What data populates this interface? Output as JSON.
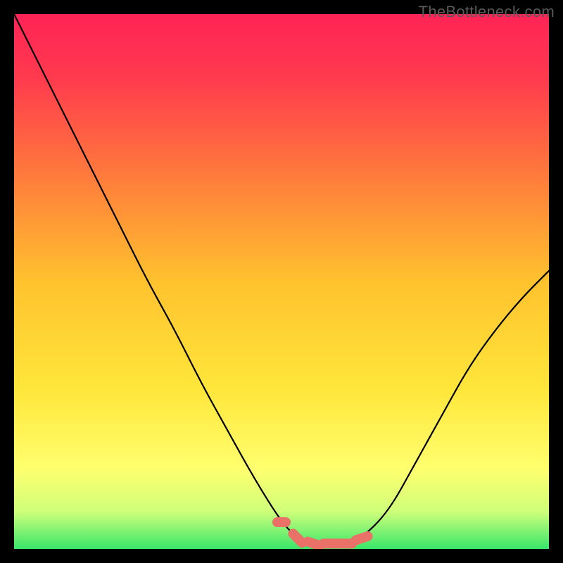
{
  "watermark": "TheBottleneck.com",
  "colors": {
    "frame": "#000000",
    "curve": "#000000",
    "marker": "#e97168",
    "gradient_top": "#ff2456",
    "gradient_mid": "#ffd02a",
    "gradient_low": "#ffff6e",
    "gradient_band": "#cfff7a",
    "gradient_bottom": "#39e66b"
  },
  "chart_data": {
    "type": "line",
    "title": "",
    "xlabel": "",
    "ylabel": "",
    "x": [
      0.0,
      0.05,
      0.1,
      0.15,
      0.2,
      0.25,
      0.3,
      0.35,
      0.4,
      0.45,
      0.5,
      0.53,
      0.56,
      0.59,
      0.62,
      0.65,
      0.7,
      0.75,
      0.8,
      0.85,
      0.9,
      0.95,
      1.0
    ],
    "values": [
      1.0,
      0.9,
      0.8,
      0.7,
      0.6,
      0.5,
      0.41,
      0.31,
      0.22,
      0.13,
      0.05,
      0.02,
      0.01,
      0.01,
      0.01,
      0.02,
      0.07,
      0.16,
      0.25,
      0.34,
      0.41,
      0.47,
      0.52
    ],
    "xlim": [
      0,
      1
    ],
    "ylim": [
      0,
      1
    ],
    "markers": {
      "x": [
        0.5,
        0.53,
        0.56,
        0.59,
        0.62,
        0.65
      ],
      "y": [
        0.05,
        0.02,
        0.01,
        0.01,
        0.01,
        0.02
      ]
    }
  }
}
